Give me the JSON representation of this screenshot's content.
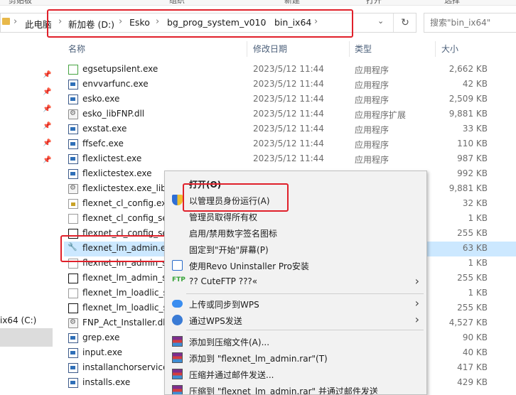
{
  "ribbon": [
    "剪贴板",
    "组织",
    "新建",
    "打开",
    "选择"
  ],
  "address": {
    "crumbs": [
      "此电脑",
      "新加卷 (D:)",
      "Esko",
      "bg_prog_system_v010",
      "bin_ix64"
    ],
    "refresh_icon": "refresh-icon"
  },
  "search": {
    "placeholder": "搜索\"bin_ix64\""
  },
  "nav": {
    "drive_label": "ix64 (C:)"
  },
  "columns": {
    "name": "名称",
    "date": "修改日期",
    "type": "类型",
    "size": "大小"
  },
  "files": [
    {
      "name": "egsetupsilent.exe",
      "date": "2023/5/12 11:44",
      "type": "应用程序",
      "size": "2,662 KB",
      "icon": "green"
    },
    {
      "name": "envvarfunc.exe",
      "date": "2023/5/12 11:44",
      "type": "应用程序",
      "size": "42 KB",
      "icon": "exe"
    },
    {
      "name": "esko.exe",
      "date": "2023/5/12 11:44",
      "type": "应用程序",
      "size": "2,509 KB",
      "icon": "exe"
    },
    {
      "name": "esko_libFNP.dll",
      "date": "2023/5/12 11:44",
      "type": "应用程序扩展",
      "size": "9,881 KB",
      "icon": "dll"
    },
    {
      "name": "exstat.exe",
      "date": "2023/5/12 11:44",
      "type": "应用程序",
      "size": "33 KB",
      "icon": "exe"
    },
    {
      "name": "ffsefc.exe",
      "date": "2023/5/12 11:44",
      "type": "应用程序",
      "size": "110 KB",
      "icon": "exe"
    },
    {
      "name": "flexlictest.exe",
      "date": "2023/5/12 11:44",
      "type": "应用程序",
      "size": "987 KB",
      "icon": "exe"
    },
    {
      "name": "flexlictestex.exe",
      "date": "",
      "type": "",
      "size": "992 KB",
      "icon": "exe"
    },
    {
      "name": "flexlictestex.exe_libF",
      "date": "",
      "type": "",
      "size": "9,881 KB",
      "icon": "dll"
    },
    {
      "name": "flexnet_cl_config.exe",
      "date": "",
      "type": "",
      "size": "32 KB",
      "icon": "lock"
    },
    {
      "name": "flexnet_cl_config_set",
      "date": "",
      "type": "",
      "size": "1 KB",
      "icon": "blank"
    },
    {
      "name": "flexnet_cl_config_set",
      "date": "",
      "type": "",
      "size": "255 KB",
      "icon": "black"
    },
    {
      "name": "flexnet_lm_admin.ex",
      "date": "",
      "type": "",
      "size": "63 KB",
      "icon": "wrench"
    },
    {
      "name": "flexnet_lm_admin_se",
      "date": "",
      "type": "",
      "size": "1 KB",
      "icon": "blank"
    },
    {
      "name": "flexnet_lm_admin_se",
      "date": "",
      "type": "",
      "size": "255 KB",
      "icon": "black"
    },
    {
      "name": "flexnet_lm_loadlic_se",
      "date": "",
      "type": "",
      "size": "1 KB",
      "icon": "blank"
    },
    {
      "name": "flexnet_lm_loadlic_se",
      "date": "",
      "type": "",
      "size": "255 KB",
      "icon": "black"
    },
    {
      "name": "FNP_Act_Installer.dll",
      "date": "",
      "type": "",
      "size": "4,527 KB",
      "icon": "dll"
    },
    {
      "name": "grep.exe",
      "date": "",
      "type": "",
      "size": "90 KB",
      "icon": "exe"
    },
    {
      "name": "input.exe",
      "date": "",
      "type": "",
      "size": "40 KB",
      "icon": "exe"
    },
    {
      "name": "installanchorservice",
      "date": "",
      "type": "",
      "size": "417 KB",
      "icon": "exe"
    },
    {
      "name": "installs.exe",
      "date": "",
      "type": "",
      "size": "429 KB",
      "icon": "exe"
    }
  ],
  "context_menu": [
    {
      "label": "打开(O)",
      "icon": "",
      "submenu": false
    },
    {
      "label": "以管理员身份运行(A)",
      "icon": "shield",
      "submenu": false
    },
    {
      "label": "管理员取得所有权",
      "icon": "",
      "submenu": false
    },
    {
      "label": "启用/禁用数字签名图标",
      "icon": "",
      "submenu": false
    },
    {
      "label": "固定到\"开始\"屏幕(P)",
      "icon": "",
      "submenu": false
    },
    {
      "label": "使用Revo Uninstaller Pro安装",
      "icon": "revo",
      "submenu": false
    },
    {
      "label": "?? CuteFTP ???«",
      "icon": "ftp",
      "submenu": true
    },
    {
      "label": "上传或同步到WPS",
      "icon": "cloud",
      "submenu": true
    },
    {
      "label": "通过WPS发送",
      "icon": "wps",
      "submenu": true
    },
    {
      "label": "添加到压缩文件(A)...",
      "icon": "rar",
      "submenu": false
    },
    {
      "label": "添加到 \"flexnet_lm_admin.rar\"(T)",
      "icon": "rar",
      "submenu": false
    },
    {
      "label": "压缩并通过邮件发送...",
      "icon": "rar",
      "submenu": false
    },
    {
      "label": "压缩到 \"flexnet_lm_admin.rar\" 并通过邮件发送",
      "icon": "rar",
      "submenu": false
    }
  ],
  "colors": {
    "highlight": "#e0202a",
    "selection": "#cce8ff"
  }
}
